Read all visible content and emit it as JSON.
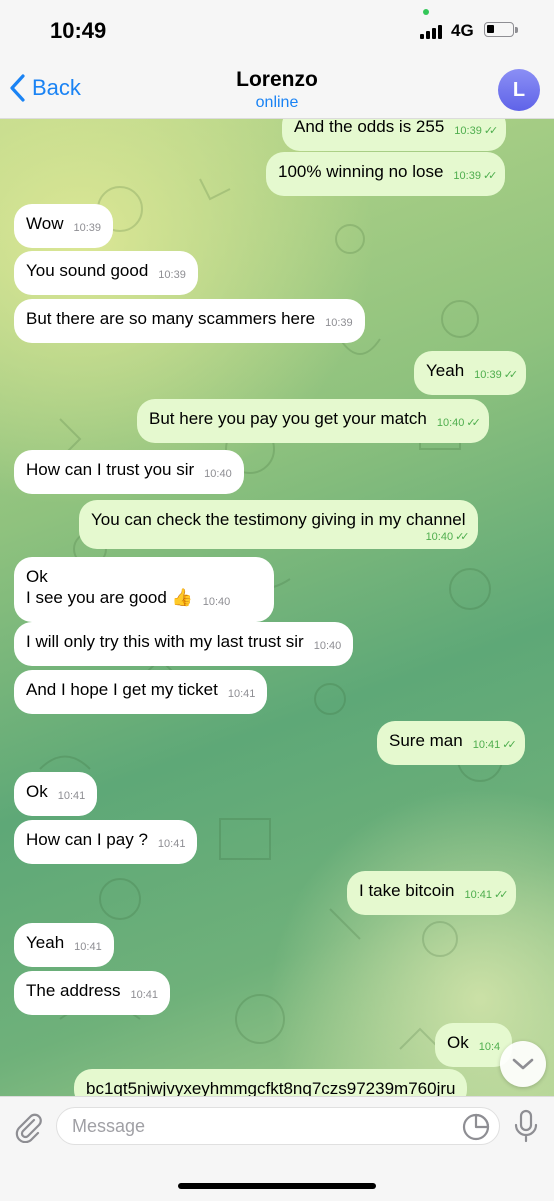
{
  "status_bar": {
    "time": "10:49",
    "network": "4G"
  },
  "header": {
    "back_label": "Back",
    "title": "Lorenzo",
    "subtitle": "online",
    "avatar_initial": "L"
  },
  "messages": [
    {
      "dir": "out",
      "text": "And the odds is 255",
      "time": "10:39",
      "read": true
    },
    {
      "dir": "out",
      "text": "100% winning no lose",
      "time": "10:39",
      "read": true
    },
    {
      "dir": "in",
      "text": "Wow",
      "time": "10:39"
    },
    {
      "dir": "in",
      "text": "You sound good",
      "time": "10:39"
    },
    {
      "dir": "in",
      "text": "But there are so many scammers here",
      "time": "10:39"
    },
    {
      "dir": "out",
      "text": "Yeah",
      "time": "10:39",
      "read": true
    },
    {
      "dir": "out",
      "text": "But here you pay you get your match",
      "time": "10:40",
      "read": true
    },
    {
      "dir": "in",
      "text": "How can I trust you sir",
      "time": "10:40"
    },
    {
      "dir": "out",
      "text": "You can check the testimony giving in my channel",
      "time": "10:40",
      "read": true
    },
    {
      "dir": "in",
      "text_line1": "Ok",
      "text_line2": "I see you are good",
      "emoji": "👍",
      "time": "10:40"
    },
    {
      "dir": "in",
      "text": "I will only try this with my last trust sir",
      "time": "10:40"
    },
    {
      "dir": "in",
      "text": "And I hope I get my ticket",
      "time": "10:41"
    },
    {
      "dir": "out",
      "text": "Sure man",
      "time": "10:41",
      "read": true
    },
    {
      "dir": "in",
      "text": "Ok",
      "time": "10:41"
    },
    {
      "dir": "in",
      "text": "How can I pay ?",
      "time": "10:41"
    },
    {
      "dir": "out",
      "text": "I take bitcoin",
      "time": "10:41",
      "read": true
    },
    {
      "dir": "in",
      "text": "Yeah",
      "time": "10:41"
    },
    {
      "dir": "in",
      "text": "The address",
      "time": "10:41"
    },
    {
      "dir": "out",
      "text": "Ok",
      "time": "10:4",
      "read": true
    },
    {
      "dir": "out",
      "text": "bc1qt5njwjvyxeyhmmgcfkt8nq7czs97239m760jru"
    }
  ],
  "input": {
    "placeholder": "Message"
  },
  "colors": {
    "accent": "#1a83f4",
    "outgoing_bubble": "#e5f9cf",
    "incoming_bubble": "#ffffff",
    "read_tick": "#4fae4e"
  }
}
